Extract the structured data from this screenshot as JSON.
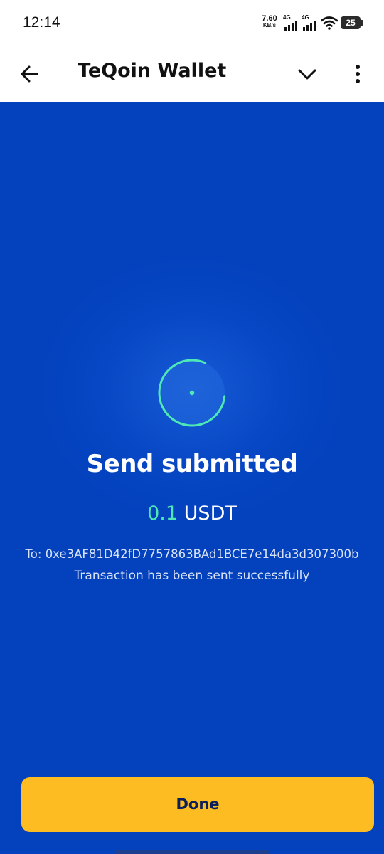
{
  "status_bar": {
    "time": "12:14",
    "net_speed_value": "7.60",
    "net_speed_unit": "KB/s",
    "signal_1_label": "4G",
    "signal_2_label": "4G",
    "battery_level": "25",
    "icons": [
      "network-speed",
      "signal-4g-icon",
      "signal-4g-icon",
      "wifi-icon",
      "battery-icon"
    ]
  },
  "header": {
    "title": "TeQoin Wallet",
    "icons": [
      "back-arrow-icon",
      "chevron-down-icon",
      "more-vertical-icon"
    ]
  },
  "main": {
    "headline": "Send submitted",
    "amount": "0.1",
    "currency": "USDT",
    "recipient_label": "To:",
    "recipient_address": "0xe3AF81D42fD7757863BAd1BCE7e14da3d307300b",
    "status_message": "Transaction has been sent successfully",
    "done_label": "Done"
  },
  "colors": {
    "background": "#0341bd",
    "accent_green": "#4ee8b5",
    "button_yellow": "#fcbc22",
    "button_text": "#0b1f5c"
  }
}
